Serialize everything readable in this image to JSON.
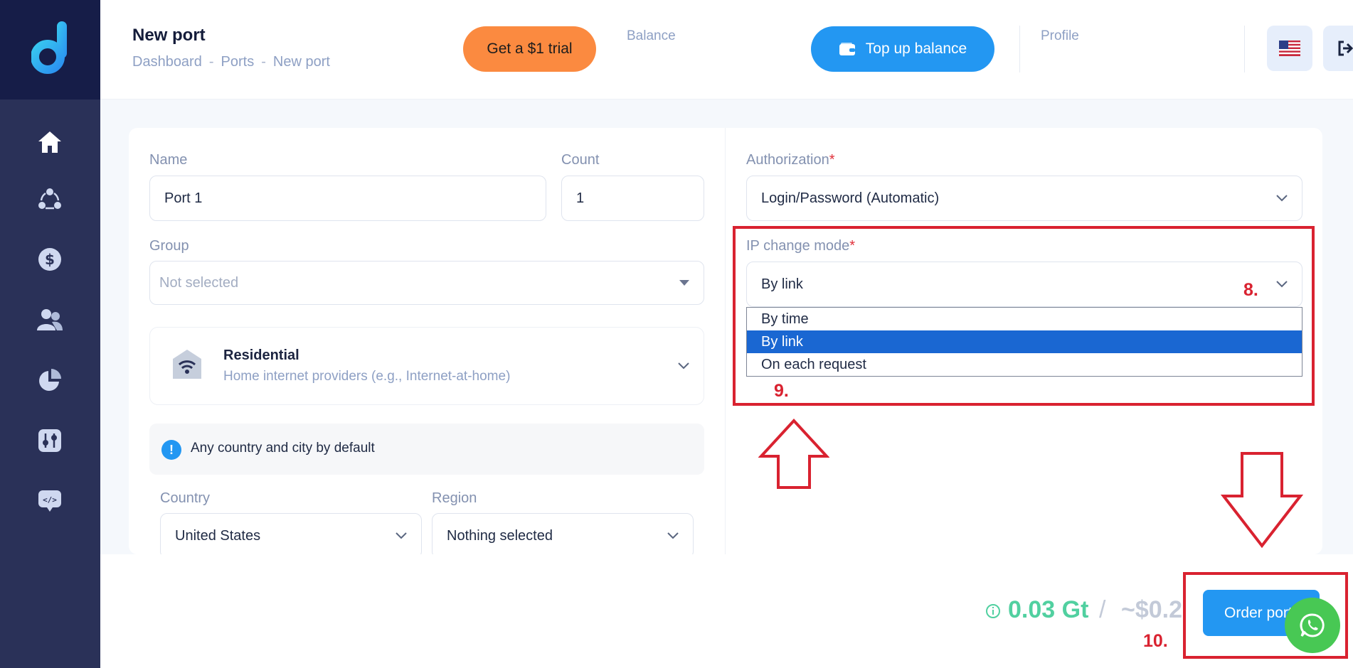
{
  "header": {
    "title": "New port",
    "breadcrumb": [
      "Dashboard",
      "Ports",
      "New port"
    ],
    "breadcrumb_separator": "-",
    "trial_button": "Get a $1 trial",
    "balance_label": "Balance",
    "topup_button": "Top up balance",
    "profile_label": "Profile"
  },
  "sidebar": {
    "icons": [
      "home-icon",
      "network-icon",
      "dollar-icon",
      "users-icon",
      "pie-chart-icon",
      "sliders-icon",
      "code-icon"
    ]
  },
  "form": {
    "name_label": "Name",
    "name_value": "Port 1",
    "count_label": "Count",
    "count_value": "1",
    "group_label": "Group",
    "group_placeholder": "Not selected",
    "proxy_type_title": "Residential",
    "proxy_type_subtitle": "Home internet providers (e.g., Internet-at-home)",
    "info_text": "Any country and city by default",
    "country_label": "Country",
    "country_value": "United States",
    "region_label": "Region",
    "region_value": "Nothing selected",
    "auth_label": "Authorization",
    "auth_value": "Login/Password (Automatic)",
    "ip_mode_label": "IP change mode",
    "required_mark": "*",
    "ip_mode_value": "By link",
    "ip_mode_options": [
      "By time",
      "By link",
      "On each request"
    ],
    "ip_mode_selected": "By link"
  },
  "annotations": {
    "step8": "8.",
    "step9": "9.",
    "step10": "10."
  },
  "footer": {
    "price_gt": "0.03 Gt",
    "price_slash": "/",
    "price_usd": "~$0.2",
    "order_button": "Order port"
  },
  "colors": {
    "sidebar": "#2a3158",
    "sidebar_logo_bg": "#161d48",
    "accent_blue": "#2397f2",
    "trial_orange": "#fb8a40",
    "annotation_red": "#d92230",
    "price_green": "#51d0a0",
    "whatsapp_green": "#48c854"
  }
}
